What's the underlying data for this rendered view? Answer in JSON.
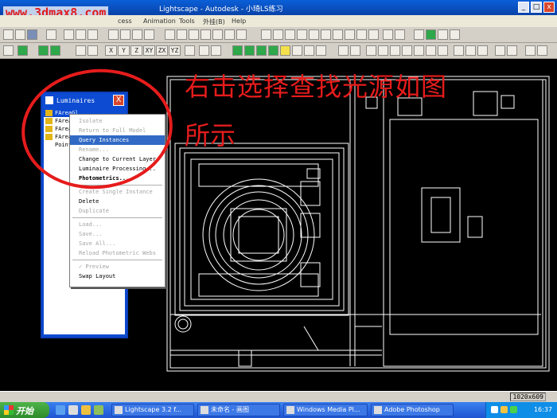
{
  "window": {
    "title": "Lightscape - Autodesk - 小琦LS练习",
    "watermark": "www.3dmax8.com",
    "minimize_label": "_",
    "restore_label": "□",
    "close_label": "x"
  },
  "menubar": {
    "items": [
      "cess",
      "Animation",
      "Tools",
      "外挂(B)",
      "Help"
    ]
  },
  "toolbar": {
    "axis_labels": [
      "X",
      "Y",
      "Z",
      "XY",
      "ZX",
      "YZ"
    ]
  },
  "annotation": {
    "line1": "右击选择查找光源如图",
    "line2": "所示"
  },
  "luminaires": {
    "title": "Luminaires",
    "close_label": "X",
    "items": [
      {
        "label": "FAreaGl",
        "selected": true
      },
      {
        "label": "FAreaGl",
        "selected": false
      },
      {
        "label": "FAreaGl",
        "selected": false
      },
      {
        "label": "FAreaGl",
        "selected": false
      },
      {
        "label": "Point",
        "selected": false
      }
    ]
  },
  "context_menu": {
    "items": [
      {
        "label": "Isolate",
        "disabled": true
      },
      {
        "label": "Return to Full Model",
        "disabled": true
      },
      {
        "label": "Query Instances",
        "highlighted": true
      },
      {
        "label": "Rename...",
        "disabled": true
      },
      {
        "label": "Change to Current Layer"
      },
      {
        "label": "Luminaire Processing..."
      },
      {
        "label": "Photometrics...",
        "bold": true
      },
      {
        "separator": true
      },
      {
        "label": "Create Single Instance",
        "disabled": true
      },
      {
        "label": "Delete"
      },
      {
        "label": "Duplicate",
        "disabled": true
      },
      {
        "separator": true
      },
      {
        "label": "Load...",
        "disabled": true
      },
      {
        "label": "Save...",
        "disabled": true
      },
      {
        "label": "Save All...",
        "disabled": true
      },
      {
        "label": "Reload Photometric Webs",
        "disabled": true
      },
      {
        "separator": true
      },
      {
        "label": "✓ Preview",
        "disabled": true
      },
      {
        "label": "Swap Layout"
      }
    ]
  },
  "status": {
    "resolution": "1020x609"
  },
  "taskbar": {
    "start_label": "开始",
    "tasks": [
      {
        "label": "Lightscape 3.2 f...",
        "active": false
      },
      {
        "label": "未命名 - 画图",
        "active": false
      },
      {
        "label": "Windows Media Pl...",
        "active": false
      },
      {
        "label": "Adobe Photoshop",
        "active": false
      }
    ],
    "clock": "16:37"
  },
  "colors": {
    "annotation": "#e61c1c",
    "selection": "#316ac5",
    "titlebar": "#0a5fd8"
  }
}
